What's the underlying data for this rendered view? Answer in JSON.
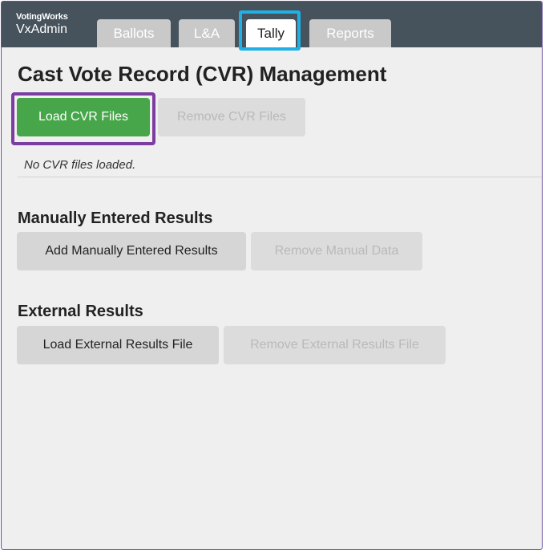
{
  "header": {
    "org": "VotingWorks",
    "app": "VxAdmin",
    "tabs": [
      {
        "label": "Ballots"
      },
      {
        "label": "L&A"
      },
      {
        "label": "Tally"
      },
      {
        "label": "Reports"
      }
    ]
  },
  "main": {
    "title": "Cast Vote Record (CVR) Management",
    "cvr": {
      "load_label": "Load CVR Files",
      "remove_label": "Remove CVR Files",
      "status": "No CVR files loaded."
    },
    "manual": {
      "heading": "Manually Entered Results",
      "add_label": "Add Manually Entered Results",
      "remove_label": "Remove Manual Data"
    },
    "external": {
      "heading": "External Results",
      "load_label": "Load External Results File",
      "remove_label": "Remove External Results File"
    }
  },
  "colors": {
    "header_bg": "#46535c",
    "primary_button": "#47a64a",
    "tab_highlight": "#1fb1e6",
    "button_highlight": "#7b3da0"
  }
}
